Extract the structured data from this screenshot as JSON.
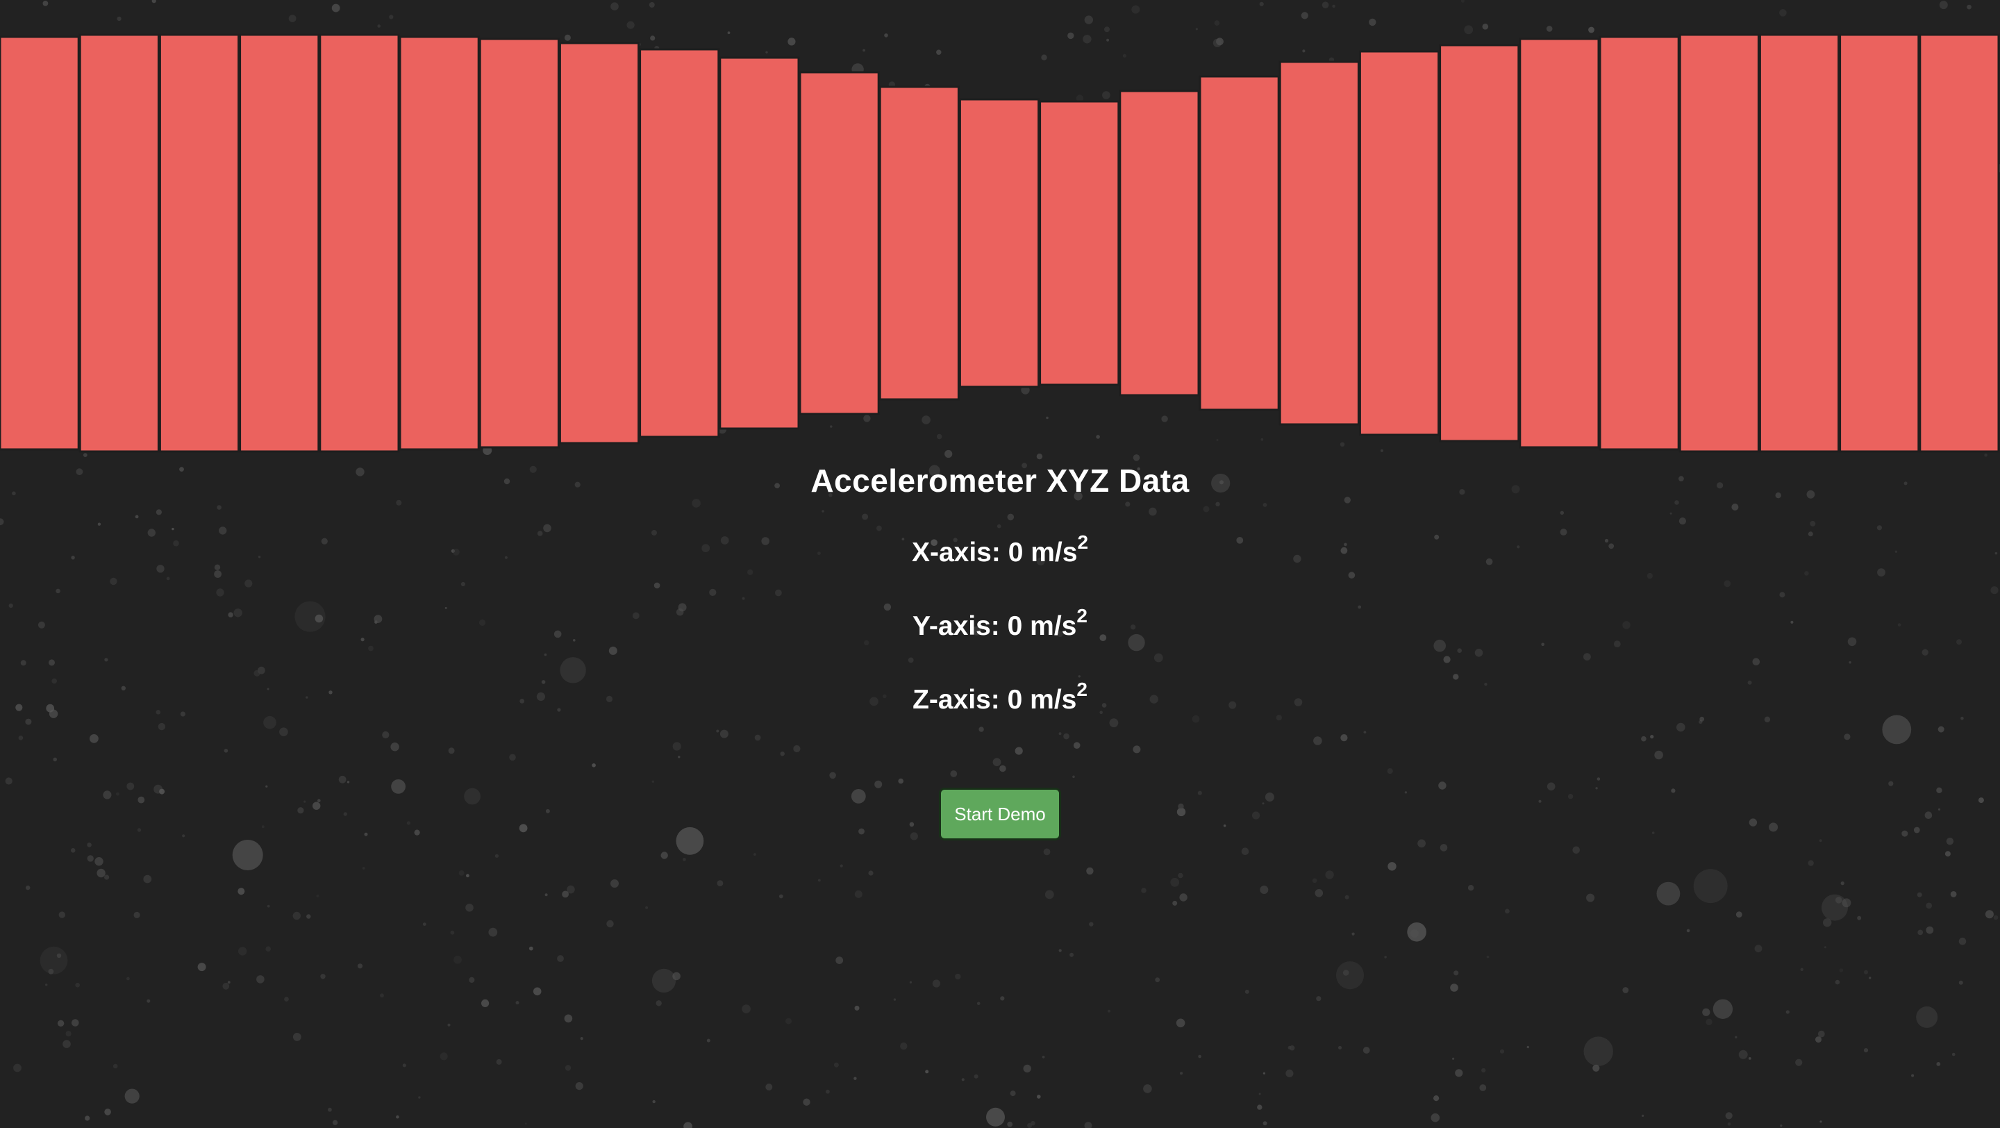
{
  "page": {
    "title": "Accelerometer XYZ Data",
    "unit": "m/s",
    "unit_exponent": "2"
  },
  "readings": {
    "x_label": "X-axis:",
    "x_value": "0",
    "y_label": "Y-axis:",
    "y_value": "0",
    "z_label": "Z-axis:",
    "z_value": "0"
  },
  "controls": {
    "start_label": "Start Demo"
  },
  "colors": {
    "background": "#222222",
    "bar_fill": "#eb625e",
    "bar_border": "#1e1e1e",
    "button_fill": "#5fa85c",
    "text": "#ffffff"
  },
  "chart_data": {
    "type": "bar",
    "title": "",
    "xlabel": "",
    "ylabel": "",
    "bar_count": 25,
    "ylim": [
      0,
      1
    ],
    "values": [
      0.99,
      1.0,
      1.0,
      1.0,
      1.0,
      0.99,
      0.98,
      0.96,
      0.93,
      0.89,
      0.82,
      0.75,
      0.69,
      0.68,
      0.73,
      0.8,
      0.87,
      0.92,
      0.95,
      0.98,
      0.99,
      1.0,
      1.0,
      1.0,
      1.0
    ],
    "grid": false,
    "legend": "none"
  }
}
